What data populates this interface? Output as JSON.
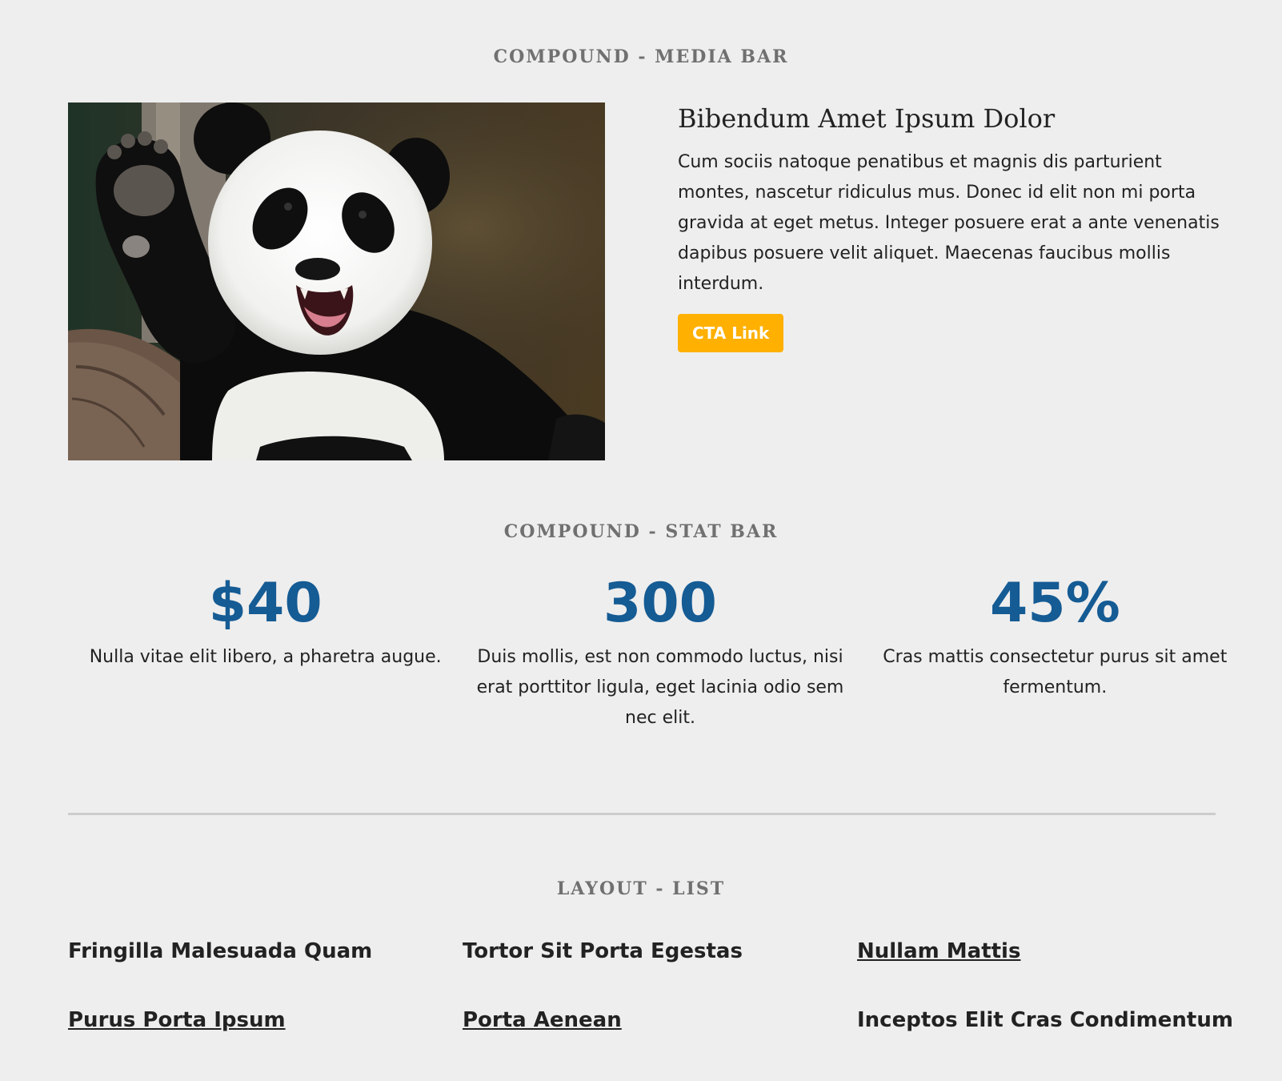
{
  "media_bar": {
    "section_title": "COMPOUND - MEDIA BAR",
    "heading": "Bibendum Amet Ipsum Dolor",
    "body": "Cum sociis natoque penatibus et magnis dis parturient montes, nascetur ridiculus mus. Donec id elit non mi porta gravida at eget metus. Integer posuere erat a ante venenatis dapibus posuere velit aliquet. Maecenas faucibus mollis interdum.",
    "cta_label": "CTA Link",
    "cta_color": "#ffb000"
  },
  "stat_bar": {
    "section_title": "COMPOUND - STAT BAR",
    "stat_color": "#155b94",
    "stats": [
      {
        "value": "$40",
        "description": "Nulla vitae elit libero, a pharetra augue."
      },
      {
        "value": "300",
        "description": "Duis mollis, est non commodo luctus, nisi erat porttitor ligula, eget lacinia odio sem nec elit."
      },
      {
        "value": "45%",
        "description": "Cras mattis consectetur purus sit amet fermentum."
      }
    ]
  },
  "layout_list": {
    "section_title": "LAYOUT - LIST",
    "items": [
      {
        "label": "Fringilla Malesuada Quam",
        "is_link": false
      },
      {
        "label": "Tortor Sit Porta Egestas",
        "is_link": false
      },
      {
        "label": "Nullam Mattis",
        "is_link": true
      },
      {
        "label": "Purus Porta Ipsum",
        "is_link": true
      },
      {
        "label": "Porta Aenean",
        "is_link": true
      },
      {
        "label": "Inceptos Elit Cras Condimentum",
        "is_link": false
      }
    ]
  }
}
